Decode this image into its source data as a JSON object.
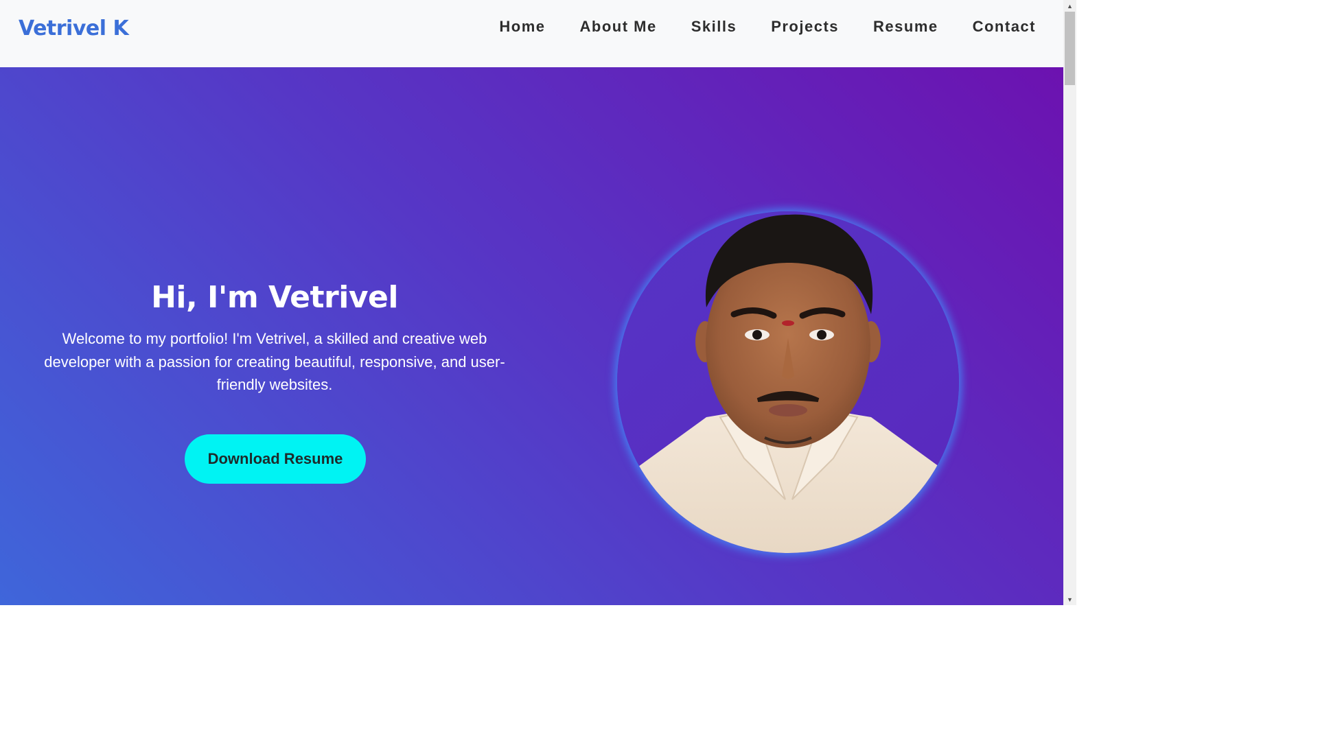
{
  "navbar": {
    "brand": "Vetrivel K",
    "links": [
      "Home",
      "About Me",
      "Skills",
      "Projects",
      "Resume",
      "Contact"
    ]
  },
  "hero": {
    "title": "Hi, I'm Vetrivel",
    "description": "Welcome to my portfolio! I'm Vetrivel, a skilled and creative web developer with a passion for creating beautiful, responsive, and user-friendly websites.",
    "cta_label": "Download Resume"
  },
  "scrollbar": {
    "up_icon": "triangle-up",
    "down_icon": "triangle-down"
  },
  "colors": {
    "brand": "#3b6fd8",
    "cta": "#00f3f3",
    "gradient_start": "#3f66da",
    "gradient_end": "#6c12b0",
    "photo_glow": "#4096ff"
  }
}
